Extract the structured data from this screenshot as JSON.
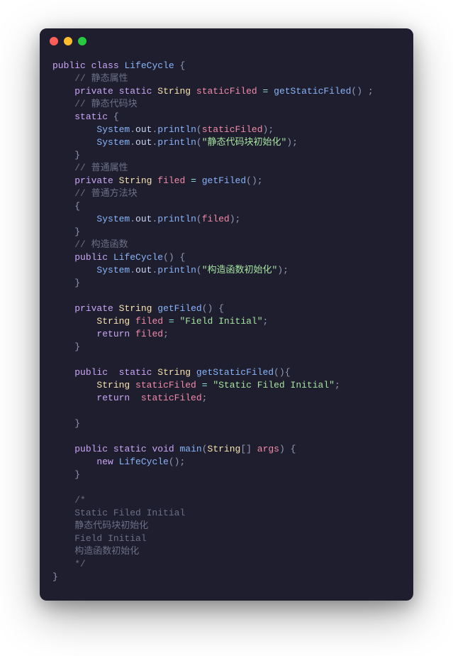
{
  "titlebar": {
    "dots": [
      "red",
      "yellow",
      "green"
    ]
  },
  "tokens": [
    {
      "t": "public",
      "c": "kw"
    },
    {
      "t": " ",
      "c": ""
    },
    {
      "t": "class",
      "c": "kw"
    },
    {
      "t": " ",
      "c": ""
    },
    {
      "t": "LifeCycle",
      "c": "cls"
    },
    {
      "t": " ",
      "c": ""
    },
    {
      "t": "{",
      "c": "br"
    },
    {
      "t": "\n",
      "c": ""
    },
    {
      "t": "    ",
      "c": ""
    },
    {
      "t": "// 静态属性",
      "c": "cmt"
    },
    {
      "t": "\n",
      "c": ""
    },
    {
      "t": "    ",
      "c": ""
    },
    {
      "t": "private",
      "c": "kw"
    },
    {
      "t": " ",
      "c": ""
    },
    {
      "t": "static",
      "c": "kw"
    },
    {
      "t": " ",
      "c": ""
    },
    {
      "t": "String",
      "c": "typ"
    },
    {
      "t": " ",
      "c": ""
    },
    {
      "t": "staticFiled",
      "c": "var"
    },
    {
      "t": " ",
      "c": ""
    },
    {
      "t": "=",
      "c": "op"
    },
    {
      "t": " ",
      "c": ""
    },
    {
      "t": "getStaticFiled",
      "c": "fn"
    },
    {
      "t": "(",
      "c": "pn"
    },
    {
      "t": ")",
      "c": "pn"
    },
    {
      "t": " ",
      "c": ""
    },
    {
      "t": ";",
      "c": "pn"
    },
    {
      "t": "\n",
      "c": ""
    },
    {
      "t": "    ",
      "c": ""
    },
    {
      "t": "// 静态代码块",
      "c": "cmt"
    },
    {
      "t": "\n",
      "c": ""
    },
    {
      "t": "    ",
      "c": ""
    },
    {
      "t": "static",
      "c": "kw"
    },
    {
      "t": " ",
      "c": ""
    },
    {
      "t": "{",
      "c": "br"
    },
    {
      "t": "\n",
      "c": ""
    },
    {
      "t": "        ",
      "c": ""
    },
    {
      "t": "System",
      "c": "obj"
    },
    {
      "t": ".",
      "c": "pn"
    },
    {
      "t": "out",
      "c": "mem"
    },
    {
      "t": ".",
      "c": "pn"
    },
    {
      "t": "println",
      "c": "fn"
    },
    {
      "t": "(",
      "c": "pn"
    },
    {
      "t": "staticFiled",
      "c": "var"
    },
    {
      "t": ")",
      "c": "pn"
    },
    {
      "t": ";",
      "c": "pn"
    },
    {
      "t": "\n",
      "c": ""
    },
    {
      "t": "        ",
      "c": ""
    },
    {
      "t": "System",
      "c": "obj"
    },
    {
      "t": ".",
      "c": "pn"
    },
    {
      "t": "out",
      "c": "mem"
    },
    {
      "t": ".",
      "c": "pn"
    },
    {
      "t": "println",
      "c": "fn"
    },
    {
      "t": "(",
      "c": "pn"
    },
    {
      "t": "\"静态代码块初始化\"",
      "c": "str"
    },
    {
      "t": ")",
      "c": "pn"
    },
    {
      "t": ";",
      "c": "pn"
    },
    {
      "t": "\n",
      "c": ""
    },
    {
      "t": "    ",
      "c": ""
    },
    {
      "t": "}",
      "c": "br"
    },
    {
      "t": "\n",
      "c": ""
    },
    {
      "t": "    ",
      "c": ""
    },
    {
      "t": "// 普通属性",
      "c": "cmt"
    },
    {
      "t": "\n",
      "c": ""
    },
    {
      "t": "    ",
      "c": ""
    },
    {
      "t": "private",
      "c": "kw"
    },
    {
      "t": " ",
      "c": ""
    },
    {
      "t": "String",
      "c": "typ"
    },
    {
      "t": " ",
      "c": ""
    },
    {
      "t": "filed",
      "c": "var"
    },
    {
      "t": " ",
      "c": ""
    },
    {
      "t": "=",
      "c": "op"
    },
    {
      "t": " ",
      "c": ""
    },
    {
      "t": "getFiled",
      "c": "fn"
    },
    {
      "t": "(",
      "c": "pn"
    },
    {
      "t": ")",
      "c": "pn"
    },
    {
      "t": ";",
      "c": "pn"
    },
    {
      "t": "\n",
      "c": ""
    },
    {
      "t": "    ",
      "c": ""
    },
    {
      "t": "// 普通方法块",
      "c": "cmt"
    },
    {
      "t": "\n",
      "c": ""
    },
    {
      "t": "    ",
      "c": ""
    },
    {
      "t": "{",
      "c": "br"
    },
    {
      "t": "\n",
      "c": ""
    },
    {
      "t": "        ",
      "c": ""
    },
    {
      "t": "System",
      "c": "obj"
    },
    {
      "t": ".",
      "c": "pn"
    },
    {
      "t": "out",
      "c": "mem"
    },
    {
      "t": ".",
      "c": "pn"
    },
    {
      "t": "println",
      "c": "fn"
    },
    {
      "t": "(",
      "c": "pn"
    },
    {
      "t": "filed",
      "c": "var"
    },
    {
      "t": ")",
      "c": "pn"
    },
    {
      "t": ";",
      "c": "pn"
    },
    {
      "t": "\n",
      "c": ""
    },
    {
      "t": "    ",
      "c": ""
    },
    {
      "t": "}",
      "c": "br"
    },
    {
      "t": "\n",
      "c": ""
    },
    {
      "t": "    ",
      "c": ""
    },
    {
      "t": "// 构造函数",
      "c": "cmt"
    },
    {
      "t": "\n",
      "c": ""
    },
    {
      "t": "    ",
      "c": ""
    },
    {
      "t": "public",
      "c": "kw"
    },
    {
      "t": " ",
      "c": ""
    },
    {
      "t": "LifeCycle",
      "c": "cls"
    },
    {
      "t": "(",
      "c": "pn"
    },
    {
      "t": ")",
      "c": "pn"
    },
    {
      "t": " ",
      "c": ""
    },
    {
      "t": "{",
      "c": "br"
    },
    {
      "t": "\n",
      "c": ""
    },
    {
      "t": "        ",
      "c": ""
    },
    {
      "t": "System",
      "c": "obj"
    },
    {
      "t": ".",
      "c": "pn"
    },
    {
      "t": "out",
      "c": "mem"
    },
    {
      "t": ".",
      "c": "pn"
    },
    {
      "t": "println",
      "c": "fn"
    },
    {
      "t": "(",
      "c": "pn"
    },
    {
      "t": "\"构造函数初始化\"",
      "c": "str"
    },
    {
      "t": ")",
      "c": "pn"
    },
    {
      "t": ";",
      "c": "pn"
    },
    {
      "t": "\n",
      "c": ""
    },
    {
      "t": "    ",
      "c": ""
    },
    {
      "t": "}",
      "c": "br"
    },
    {
      "t": "\n",
      "c": ""
    },
    {
      "t": "\n",
      "c": ""
    },
    {
      "t": "    ",
      "c": ""
    },
    {
      "t": "private",
      "c": "kw"
    },
    {
      "t": " ",
      "c": ""
    },
    {
      "t": "String",
      "c": "typ"
    },
    {
      "t": " ",
      "c": ""
    },
    {
      "t": "getFiled",
      "c": "cls"
    },
    {
      "t": "(",
      "c": "pn"
    },
    {
      "t": ")",
      "c": "pn"
    },
    {
      "t": " ",
      "c": ""
    },
    {
      "t": "{",
      "c": "br"
    },
    {
      "t": "\n",
      "c": ""
    },
    {
      "t": "        ",
      "c": ""
    },
    {
      "t": "String",
      "c": "typ"
    },
    {
      "t": " ",
      "c": ""
    },
    {
      "t": "filed",
      "c": "var"
    },
    {
      "t": " ",
      "c": ""
    },
    {
      "t": "=",
      "c": "op"
    },
    {
      "t": " ",
      "c": ""
    },
    {
      "t": "\"Field Initial\"",
      "c": "str"
    },
    {
      "t": ";",
      "c": "pn"
    },
    {
      "t": "\n",
      "c": ""
    },
    {
      "t": "        ",
      "c": ""
    },
    {
      "t": "return",
      "c": "kw"
    },
    {
      "t": " ",
      "c": ""
    },
    {
      "t": "filed",
      "c": "var"
    },
    {
      "t": ";",
      "c": "pn"
    },
    {
      "t": "\n",
      "c": ""
    },
    {
      "t": "    ",
      "c": ""
    },
    {
      "t": "}",
      "c": "br"
    },
    {
      "t": "\n",
      "c": ""
    },
    {
      "t": "\n",
      "c": ""
    },
    {
      "t": "    ",
      "c": ""
    },
    {
      "t": "public",
      "c": "kw"
    },
    {
      "t": "  ",
      "c": ""
    },
    {
      "t": "static",
      "c": "kw"
    },
    {
      "t": " ",
      "c": ""
    },
    {
      "t": "String",
      "c": "typ"
    },
    {
      "t": " ",
      "c": ""
    },
    {
      "t": "getStaticFiled",
      "c": "cls"
    },
    {
      "t": "(",
      "c": "pn"
    },
    {
      "t": ")",
      "c": "pn"
    },
    {
      "t": "{",
      "c": "br"
    },
    {
      "t": "\n",
      "c": ""
    },
    {
      "t": "        ",
      "c": ""
    },
    {
      "t": "String",
      "c": "typ"
    },
    {
      "t": " ",
      "c": ""
    },
    {
      "t": "staticFiled",
      "c": "var"
    },
    {
      "t": " ",
      "c": ""
    },
    {
      "t": "=",
      "c": "op"
    },
    {
      "t": " ",
      "c": ""
    },
    {
      "t": "\"Static Filed Initial\"",
      "c": "str"
    },
    {
      "t": ";",
      "c": "pn"
    },
    {
      "t": "\n",
      "c": ""
    },
    {
      "t": "        ",
      "c": ""
    },
    {
      "t": "return",
      "c": "kw"
    },
    {
      "t": "  ",
      "c": ""
    },
    {
      "t": "staticFiled",
      "c": "var"
    },
    {
      "t": ";",
      "c": "pn"
    },
    {
      "t": "\n",
      "c": ""
    },
    {
      "t": "\n",
      "c": ""
    },
    {
      "t": "    ",
      "c": ""
    },
    {
      "t": "}",
      "c": "br"
    },
    {
      "t": "\n",
      "c": ""
    },
    {
      "t": "\n",
      "c": ""
    },
    {
      "t": "    ",
      "c": ""
    },
    {
      "t": "public",
      "c": "kw"
    },
    {
      "t": " ",
      "c": ""
    },
    {
      "t": "static",
      "c": "kw"
    },
    {
      "t": " ",
      "c": ""
    },
    {
      "t": "void",
      "c": "kw"
    },
    {
      "t": " ",
      "c": ""
    },
    {
      "t": "main",
      "c": "cls"
    },
    {
      "t": "(",
      "c": "pn"
    },
    {
      "t": "String",
      "c": "typ"
    },
    {
      "t": "[",
      "c": "pn"
    },
    {
      "t": "]",
      "c": "pn"
    },
    {
      "t": " ",
      "c": ""
    },
    {
      "t": "args",
      "c": "var"
    },
    {
      "t": ")",
      "c": "pn"
    },
    {
      "t": " ",
      "c": ""
    },
    {
      "t": "{",
      "c": "br"
    },
    {
      "t": "\n",
      "c": ""
    },
    {
      "t": "        ",
      "c": ""
    },
    {
      "t": "new",
      "c": "kw"
    },
    {
      "t": " ",
      "c": ""
    },
    {
      "t": "LifeCycle",
      "c": "cls"
    },
    {
      "t": "(",
      "c": "pn"
    },
    {
      "t": ")",
      "c": "pn"
    },
    {
      "t": ";",
      "c": "pn"
    },
    {
      "t": "\n",
      "c": ""
    },
    {
      "t": "    ",
      "c": ""
    },
    {
      "t": "}",
      "c": "br"
    },
    {
      "t": "\n",
      "c": ""
    },
    {
      "t": "\n",
      "c": ""
    },
    {
      "t": "    ",
      "c": ""
    },
    {
      "t": "/*",
      "c": "cmt"
    },
    {
      "t": "\n",
      "c": ""
    },
    {
      "t": "    ",
      "c": ""
    },
    {
      "t": "Static Filed Initial",
      "c": "cmt"
    },
    {
      "t": "\n",
      "c": ""
    },
    {
      "t": "    ",
      "c": ""
    },
    {
      "t": "静态代码块初始化",
      "c": "cmt"
    },
    {
      "t": "\n",
      "c": ""
    },
    {
      "t": "    ",
      "c": ""
    },
    {
      "t": "Field Initial",
      "c": "cmt"
    },
    {
      "t": "\n",
      "c": ""
    },
    {
      "t": "    ",
      "c": ""
    },
    {
      "t": "构造函数初始化",
      "c": "cmt"
    },
    {
      "t": "\n",
      "c": ""
    },
    {
      "t": "    ",
      "c": ""
    },
    {
      "t": "*/",
      "c": "cmt"
    },
    {
      "t": "\n",
      "c": ""
    },
    {
      "t": "}",
      "c": "br"
    }
  ]
}
